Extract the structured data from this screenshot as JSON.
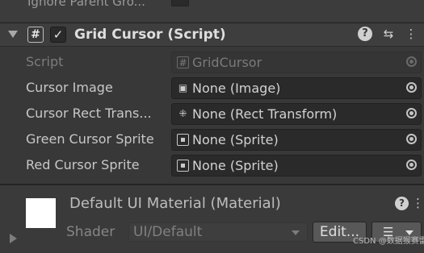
{
  "previous_component": {
    "label": "Ignore Parent Gro..."
  },
  "component": {
    "title": "Grid Cursor (Script)",
    "script_icon_glyph": "#",
    "enabled_glyph": "✓",
    "icons": [
      "help-icon",
      "preset-icon",
      "menu-icon"
    ],
    "help_glyph": "?",
    "preset_glyph": "⇆",
    "menu_glyph": "⋮"
  },
  "properties": [
    {
      "label": "Script",
      "value": "GridCursor",
      "icon": "script-icon",
      "icon_glyph": "#",
      "disabled": true
    },
    {
      "label": "Cursor Image",
      "value": "None (Image)",
      "icon": "image-icon",
      "icon_glyph": "▣"
    },
    {
      "label": "Cursor Rect Trans...",
      "value": "None (Rect Transform)",
      "icon": "rect-transform-icon",
      "icon_glyph": "⁜"
    },
    {
      "label": "Green Cursor Sprite",
      "value": "None (Sprite)",
      "icon": "sprite-icon",
      "icon_glyph": ""
    },
    {
      "label": "Red Cursor Sprite",
      "value": "None (Sprite)",
      "icon": "sprite-icon",
      "icon_glyph": ""
    }
  ],
  "material": {
    "title": "Default UI Material (Material)",
    "help_glyph": "?",
    "menu_glyph": "⋮",
    "shader_label": "Shader",
    "shader_value": "UI/Default",
    "edit_label": "Edit...",
    "list_glyph": "☰"
  },
  "watermark": "CSDN @数据猴赛雷",
  "colors": {
    "background": "#383838",
    "field": "#2a2a2a",
    "button": "#585858",
    "text": "#c8c8c8"
  }
}
